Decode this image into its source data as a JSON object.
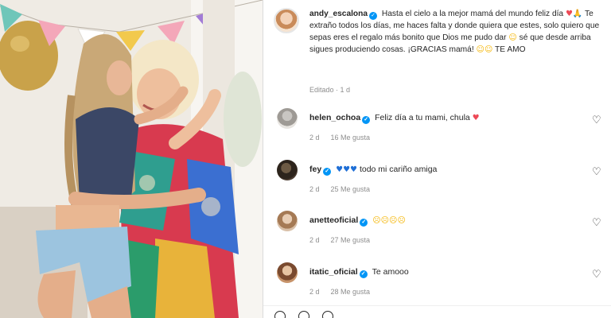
{
  "post": {
    "username": "andy_escalona",
    "caption_p1": "Hasta el cielo a la mejor mamá del mundo feliz día",
    "caption_p2": "Te extraño todos los días, me haces falta y donde quiera que estes, solo quiero que sepas eres el regalo más bonito que Dios me pudo dar",
    "caption_p3": "sé que desde arriba sigues produciendo cosas. ¡GRACIAS mamá!",
    "caption_p4": "TE AMO",
    "edited": "Editado · 1 d"
  },
  "comments": [
    {
      "user": "helen_ochoa",
      "text": "Feliz día a tu mami, chula",
      "time": "2 d",
      "likes": "16 Me gusta"
    },
    {
      "user": "fey",
      "text": "todo mi cariño amiga",
      "time": "2 d",
      "likes": "25 Me gusta"
    },
    {
      "user": "anetteoficial",
      "text": "",
      "time": "2 d",
      "likes": "27 Me gusta"
    },
    {
      "user": "itatic_oficial",
      "text": "Te amooo",
      "time": "2 d",
      "likes": "28 Me gusta"
    }
  ],
  "icons": {
    "verified": "verified-badge",
    "like": "heart-outline-icon"
  },
  "colors": {
    "accent_verified": "#0095f6",
    "heart_red": "#ed4956",
    "secondary_text": "#8e8e8e"
  }
}
